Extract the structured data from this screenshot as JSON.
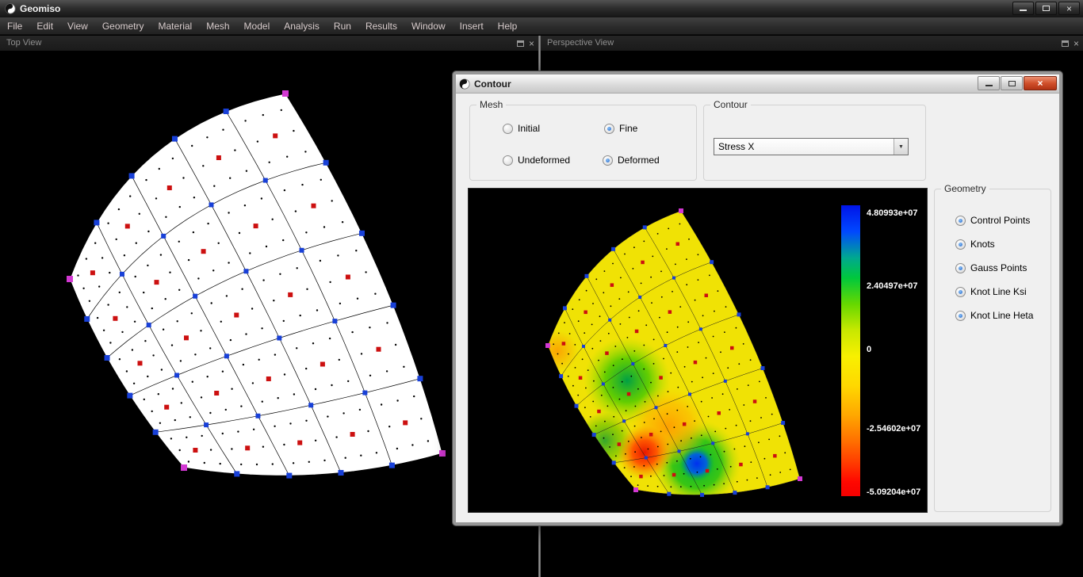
{
  "window": {
    "title": "Geomiso"
  },
  "menu": {
    "items": [
      "File",
      "Edit",
      "View",
      "Geometry",
      "Material",
      "Mesh",
      "Model",
      "Analysis",
      "Run",
      "Results",
      "Window",
      "Insert",
      "Help"
    ]
  },
  "panels": {
    "left": {
      "title": "Top View"
    },
    "right": {
      "title": "Perspective View"
    }
  },
  "dialog": {
    "title": "Contour",
    "mesh_group": {
      "label": "Mesh",
      "options": [
        {
          "label": "Initial",
          "checked": false
        },
        {
          "label": "Fine",
          "checked": true
        },
        {
          "label": "Undeformed",
          "checked": false
        },
        {
          "label": "Deformed",
          "checked": true
        }
      ]
    },
    "contour_group": {
      "label": "Contour",
      "selected": "Stress X"
    },
    "geometry_group": {
      "label": "Geometry",
      "options": [
        {
          "label": "Control Points",
          "checked": true
        },
        {
          "label": "Knots",
          "checked": true
        },
        {
          "label": "Gauss Points",
          "checked": true
        },
        {
          "label": "Knot Line Ksi",
          "checked": true
        },
        {
          "label": "Knot Line Heta",
          "checked": true
        }
      ]
    },
    "colorbar": {
      "labels": [
        "4.80993e+07",
        "2.40497e+07",
        "0",
        "-2.54602e+07",
        "-5.09204e+07"
      ],
      "positions": [
        0.027,
        0.278,
        0.496,
        0.768,
        0.986
      ]
    }
  },
  "colors": {
    "knot_blue": "#1840d8",
    "center_red": "#cc1010",
    "corner_magenta": "#d238d2",
    "contour_base": "#f0e205"
  }
}
